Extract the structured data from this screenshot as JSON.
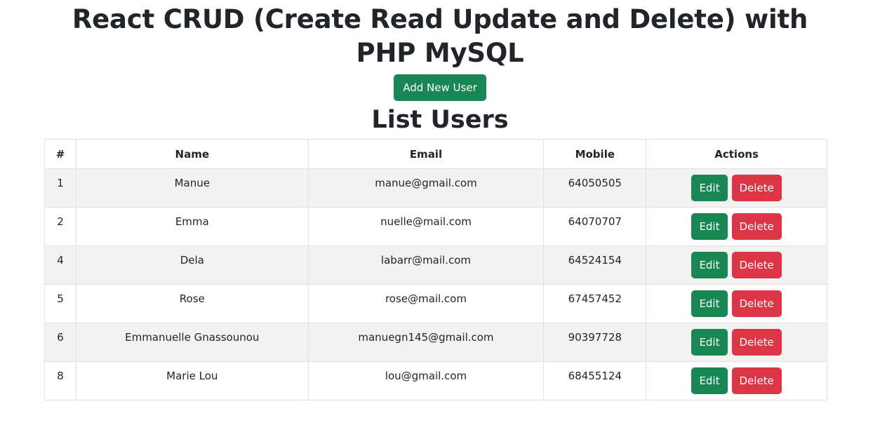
{
  "header": {
    "title": "React CRUD (Create Read Update and Delete) with PHP MySQL",
    "add_button_label": "Add New User",
    "list_title": "List Users"
  },
  "table": {
    "columns": [
      "#",
      "Name",
      "Email",
      "Mobile",
      "Actions"
    ],
    "rows": [
      {
        "id": "1",
        "name": "Manue",
        "email": "manue@gmail.com",
        "mobile": "64050505"
      },
      {
        "id": "2",
        "name": "Emma",
        "email": "nuelle@mail.com",
        "mobile": "64070707"
      },
      {
        "id": "4",
        "name": "Dela",
        "email": "labarr@mail.com",
        "mobile": "64524154"
      },
      {
        "id": "5",
        "name": "Rose",
        "email": "rose@mail.com",
        "mobile": "67457452"
      },
      {
        "id": "6",
        "name": "Emmanuelle Gnassounou",
        "email": "manuegn145@gmail.com",
        "mobile": "90397728"
      },
      {
        "id": "8",
        "name": "Marie Lou",
        "email": "lou@gmail.com",
        "mobile": "68455124"
      }
    ],
    "edit_label": "Edit",
    "delete_label": "Delete"
  },
  "colors": {
    "success": "#198754",
    "danger": "#dc3545",
    "stripe": "#f2f2f2"
  }
}
